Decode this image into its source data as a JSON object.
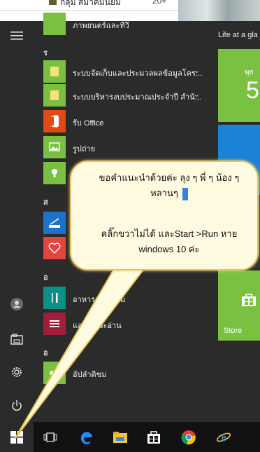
{
  "background_page": {
    "row_text": "กลุ่ม สมาคมนิยม",
    "row_count": "20+"
  },
  "start_menu": {
    "rail": {
      "menu_icon": "hamburger-icon",
      "user_icon": "user-icon",
      "explorer_icon": "file-explorer-icon",
      "settings_icon": "gear-icon",
      "power_icon": "power-icon"
    },
    "apps": [
      {
        "label": "ภาพยนตร์และทีวี",
        "color": "#7ac142"
      },
      {
        "header": "ร"
      },
      {
        "label": "ระบบจัดเก็บและประมวลผลข้อมูลโคร...",
        "color": "#7ac142",
        "expandable": true
      },
      {
        "label": "ระบบบริหารงบประมาณประจำปี สำนั...",
        "color": "#7ac142",
        "expandable": true
      },
      {
        "label": "รับ Office",
        "color": "#e24a14"
      },
      {
        "label": "รูปถ่าย",
        "color": "#7ac142"
      },
      {
        "label": "",
        "color": "#7ac142"
      },
      {
        "header": "ส"
      },
      {
        "label": "",
        "color": "#1e73c9"
      },
      {
        "label": "",
        "color": "#e2473d"
      },
      {
        "header": "อ"
      },
      {
        "label": "อาหารและ...ดิม",
        "color": "#0b8f86"
      },
      {
        "label": "แอป...ที่จะอ่าน",
        "color": "#a01d3c"
      },
      {
        "header": "อ"
      },
      {
        "label": "อัปลำดิชม",
        "color": "#7ac142"
      }
    ],
    "tiles": {
      "glance_title": "Life at a gla",
      "calendar_day_name": "พุธ",
      "calendar_day_num": "5",
      "store_label": "Store"
    }
  },
  "callout": {
    "line1": "ขอคำแนะนำด้วยค่ะ ลุง ๆ พี่ ๆ น้อง ๆ หลานๆ",
    "line2": "คลิ๊กขวาไม่ได้ และStart >Run หาย windows 10 ค่ะ"
  },
  "taskbar": {
    "items": [
      "start-icon",
      "task-view-icon",
      "edge-icon",
      "file-explorer-icon",
      "store-icon",
      "chrome-icon",
      "internet-explorer-icon"
    ]
  },
  "colors": {
    "accent_green": "#7ac142",
    "menu_bg": "#2b2b2b",
    "taskbar_bg": "#111111",
    "callout_fill": "#fffbe0",
    "callout_border": "#e8c55c"
  }
}
